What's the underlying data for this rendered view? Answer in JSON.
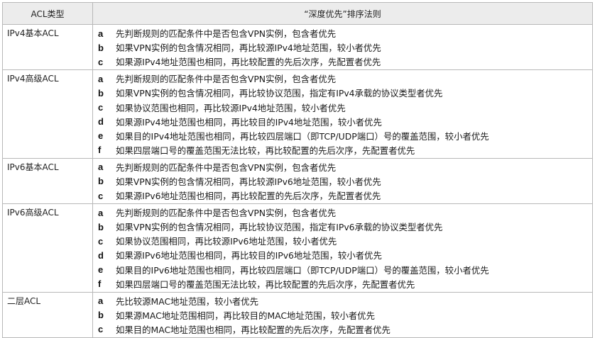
{
  "header": {
    "col_type": "ACL类型",
    "col_rules": "“深度优先”排序法则"
  },
  "groups": [
    {
      "type": "IPv4基本ACL",
      "rules": [
        {
          "letter": "a",
          "text": "先判断规则的匹配条件中是否包含VPN实例，包含者优先"
        },
        {
          "letter": "b",
          "text": "如果VPN实例的包含情况相同，再比较源IPv4地址范围，较小者优先"
        },
        {
          "letter": "c",
          "text": "如果源IPv4地址范围也相同，再比较配置的先后次序，先配置者优先"
        }
      ]
    },
    {
      "type": "IPv4高级ACL",
      "rules": [
        {
          "letter": "a",
          "text": "先判断规则的匹配条件中是否包含VPN实例，包含者优先"
        },
        {
          "letter": "b",
          "text": "如果VPN实例的包含情况相同，再比较协议范围，指定有IPv4承载的协议类型者优先"
        },
        {
          "letter": "c",
          "text": "如果协议范围也相同，再比较源IPv4地址范围，较小者优先"
        },
        {
          "letter": "d",
          "text": "如果源IPv4地址范围也相同，再比较目的IPv4地址范围，较小者优先"
        },
        {
          "letter": "e",
          "text": "如果目的IPv4地址范围也相同，再比较四层端口（即TCP/UDP端口）号的覆盖范围，较小者优先"
        },
        {
          "letter": "f",
          "text": "如果四层端口号的覆盖范围无法比较，再比较配置的先后次序，先配置者优先"
        }
      ]
    },
    {
      "type": "IPv6基本ACL",
      "rules": [
        {
          "letter": "a",
          "text": "先判断规则的匹配条件中是否包含VPN实例，包含者优先"
        },
        {
          "letter": "b",
          "text": "如果VPN实例的包含情况相同，再比较源IPv6地址范围，较小者优先"
        },
        {
          "letter": "c",
          "text": "如果源IPv6地址范围也相同，再比较配置的先后次序，先配置者优先"
        }
      ]
    },
    {
      "type": "IPv6高级ACL",
      "rules": [
        {
          "letter": "a",
          "text": "先判断规则的匹配条件中是否包含VPN实例，包含者优先"
        },
        {
          "letter": "b",
          "text": "如果VPN实例的包含情况相同，再比较协议范围，指定有IPv6承载的协议类型者优先"
        },
        {
          "letter": "c",
          "text": "如果协议范围相同，再比较源IPv6地址范围，较小者优先"
        },
        {
          "letter": "d",
          "text": "如果源IPv6地址范围也相同，再比较目的IPv6地址范围，较小者优先"
        },
        {
          "letter": "e",
          "text": "如果目的IPv6地址范围也相同，再比较四层端口（即TCP/UDP端口）号的覆盖范围，较小者优先"
        },
        {
          "letter": "f",
          "text": "如果四层端口号的覆盖范围无法比较，再比较配置的先后次序，先配置者优先"
        }
      ]
    },
    {
      "type": "二层ACL",
      "rules": [
        {
          "letter": "a",
          "text": "先比较源MAC地址范围，较小者优先"
        },
        {
          "letter": "b",
          "text": "如果源MAC地址范围相同，再比较目的MAC地址范围，较小者优先"
        },
        {
          "letter": "c",
          "text": "如果目的MAC地址范围也相同，再比较配置的先后次序，先配置者优先"
        }
      ]
    }
  ]
}
